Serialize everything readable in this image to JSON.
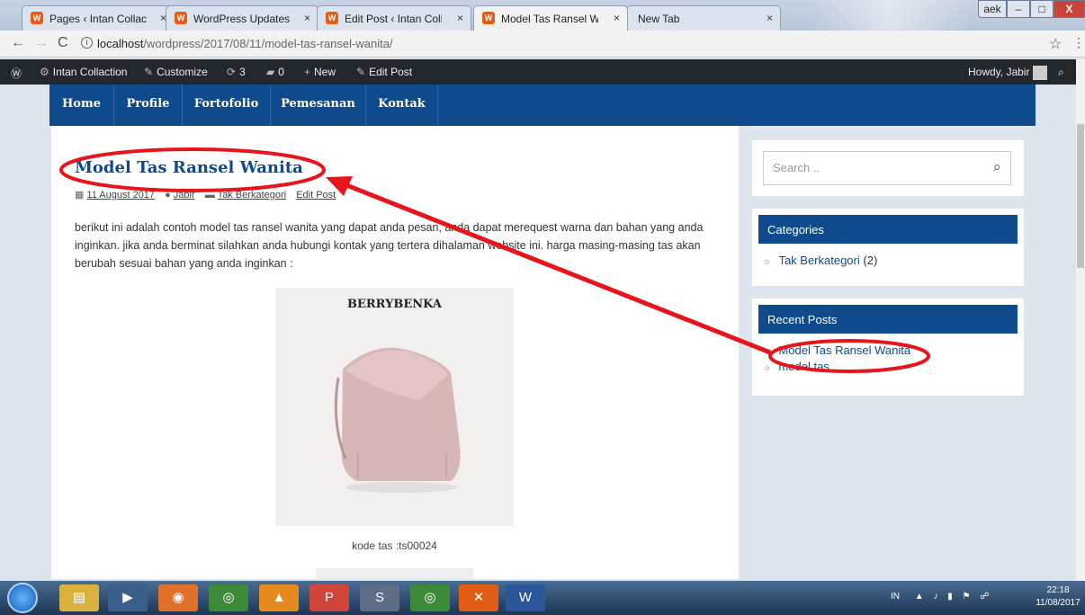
{
  "browser": {
    "tabs": [
      {
        "title": "Pages ‹ Intan Collaction –",
        "close": "×"
      },
      {
        "title": "WordPress Updates ‹ Int",
        "close": "×"
      },
      {
        "title": "Edit Post ‹ Intan Collacti",
        "close": "×"
      },
      {
        "title": "Model Tas Ransel Wanita",
        "close": "×"
      },
      {
        "title": "New Tab",
        "close": "×"
      }
    ],
    "window_controls": {
      "lang": "aek",
      "minimize": "–",
      "maximize": "□",
      "close": "X"
    },
    "url_host": "localhost",
    "url_path": "/wordpress/2017/08/11/model-tas-ransel-wanita/"
  },
  "adminbar": {
    "site_name": "Intan Collaction",
    "customize": "Customize",
    "updates": "3",
    "comments": "0",
    "new": "New",
    "edit_post": "Edit Post",
    "howdy": "Howdy, Jabir"
  },
  "nav": [
    "Home",
    "Profile",
    "Fortofolio",
    "Pemesanan",
    "Kontak"
  ],
  "post": {
    "title": "Model Tas Ransel Wanita",
    "date": "11 August 2017",
    "author": "Jabir",
    "category": "Tak Berkategori",
    "edit": "Edit Post",
    "body": "berikut ini adalah contoh model tas ransel wanita yang dapat anda pesan, anda dapat merequest warna dan bahan yang anda inginkan. jika anda berminat silahkan anda hubungi kontak yang tertera dihalaman website ini. harga masing-masing tas akan berubah sesuai bahan yang anda inginkan :",
    "image_brand": "BERRYBENKA",
    "caption": "kode tas :ts00024"
  },
  "sidebar": {
    "search_placeholder": "Search ..",
    "categories_title": "Categories",
    "categories": [
      {
        "name": "Tak Berkategori",
        "count": "(2)"
      }
    ],
    "recent_title": "Recent Posts",
    "recent": [
      "Model Tas Ransel Wanita",
      "model tas"
    ]
  },
  "taskbar": {
    "tray_lang": "IN",
    "time": "22:18",
    "date": "11/08/2017"
  },
  "colors": {
    "accent": "#0e4a8c",
    "annotation": "#e8141c"
  }
}
